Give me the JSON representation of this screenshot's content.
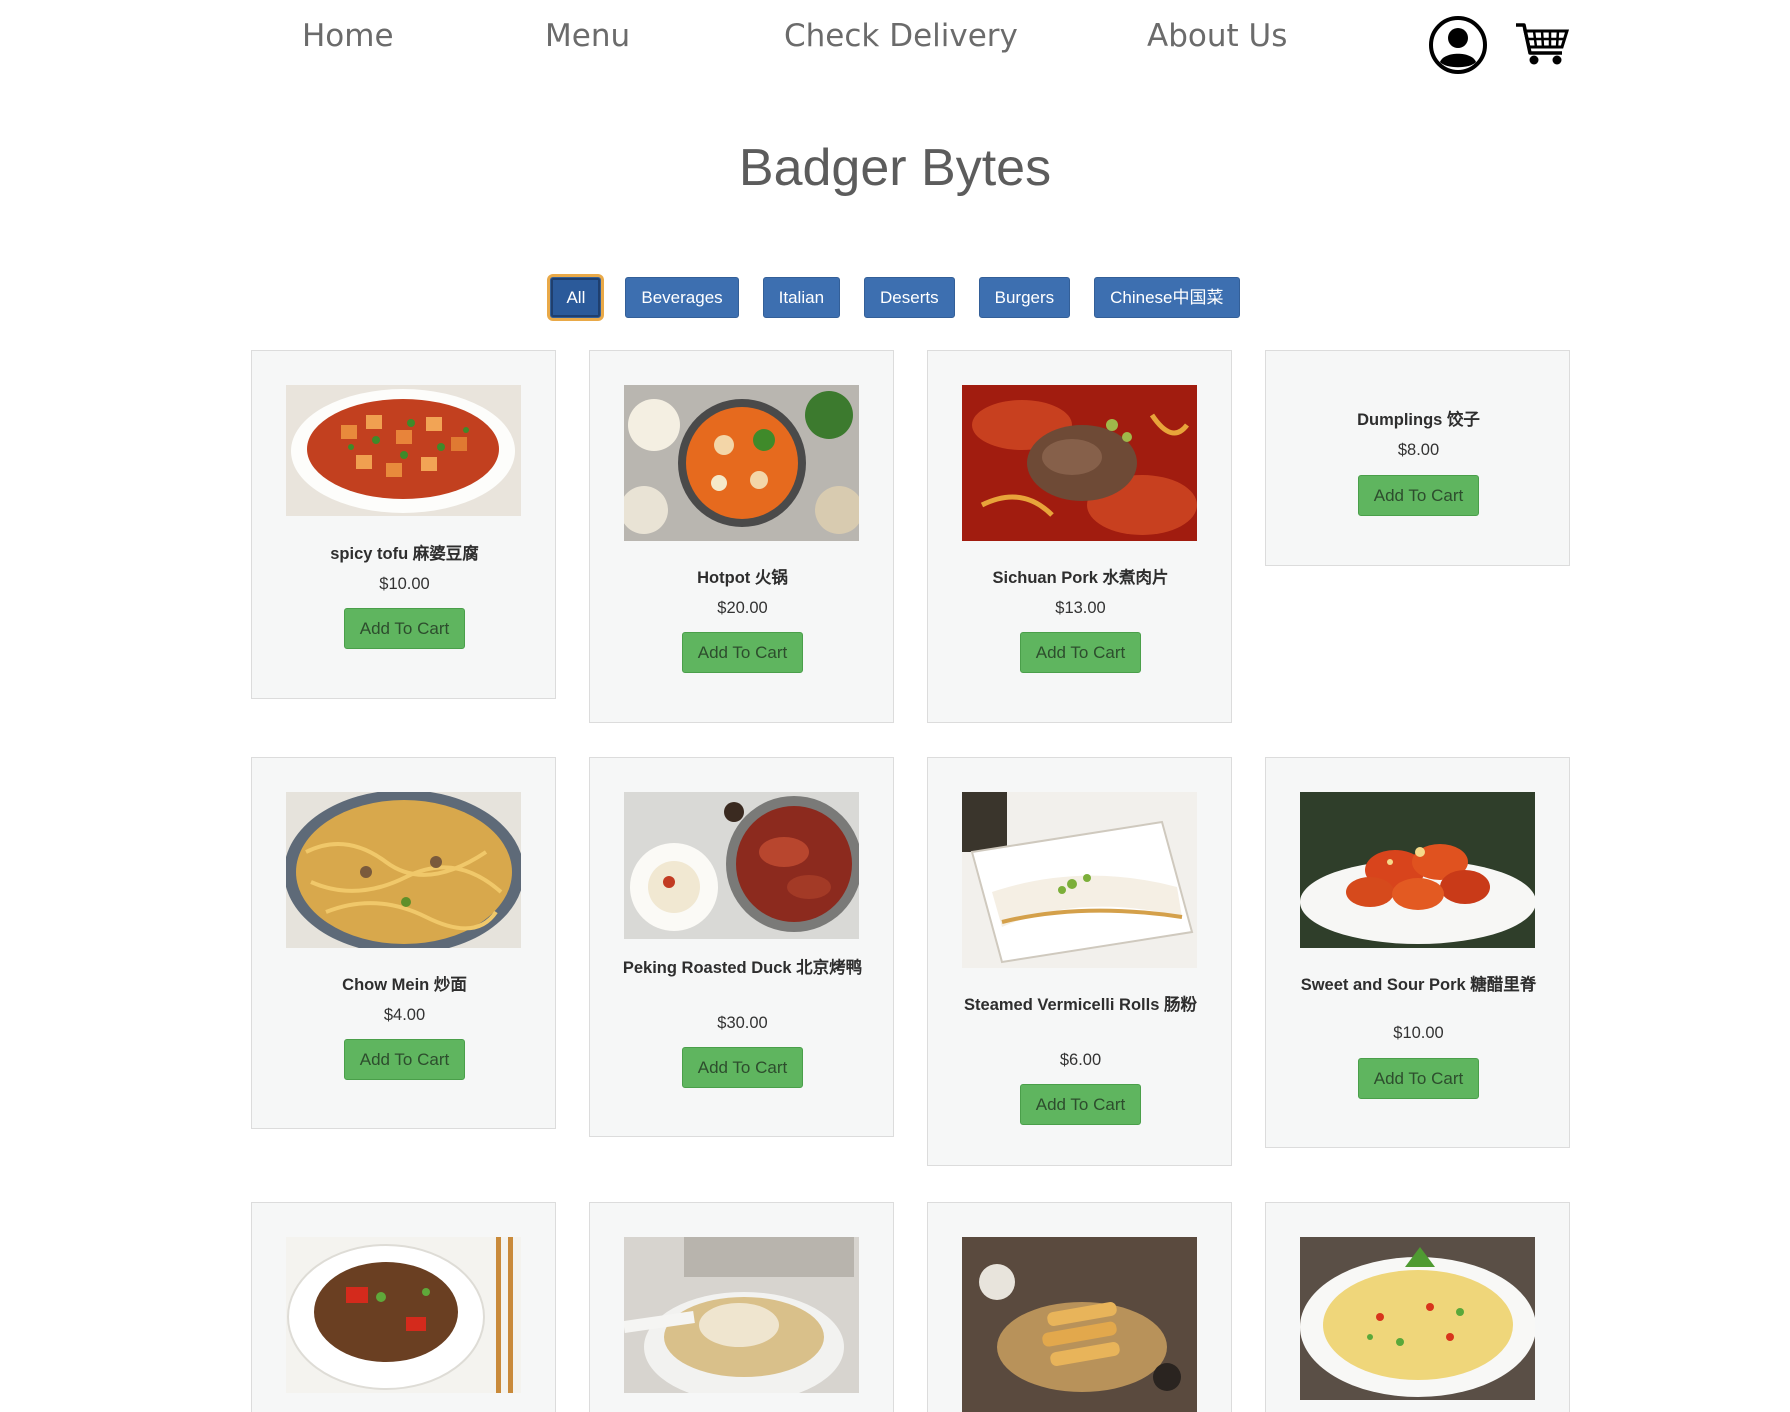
{
  "nav": {
    "home": "Home",
    "menu": "Menu",
    "check_delivery": "Check Delivery",
    "about_us": "About Us",
    "account_icon": "user-account-icon",
    "cart_icon": "shopping-cart-icon"
  },
  "title": "Badger Bytes",
  "filters": [
    {
      "label": "All",
      "active": true
    },
    {
      "label": "Beverages",
      "active": false
    },
    {
      "label": "Italian",
      "active": false
    },
    {
      "label": "Deserts",
      "active": false
    },
    {
      "label": "Burgers",
      "active": false
    },
    {
      "label": "Chinese中国菜",
      "active": false
    }
  ],
  "add_to_cart_label": "Add To Cart",
  "items": [
    {
      "name": "spicy tofu 麻婆豆腐",
      "price": "$10.00"
    },
    {
      "name": "Hotpot 火锅",
      "price": "$20.00"
    },
    {
      "name": "Sichuan Pork 水煮肉片",
      "price": "$13.00"
    },
    {
      "name": "Dumplings 饺子",
      "price": "$8.00"
    },
    {
      "name": "Chow Mein 炒面",
      "price": "$4.00"
    },
    {
      "name": "Peking Roasted Duck 北京烤鸭",
      "price": "$30.00"
    },
    {
      "name": "Steamed Vermicelli Rolls 肠粉",
      "price": "$6.00"
    },
    {
      "name": "Sweet and Sour Pork 糖醋里脊",
      "price": "$10.00"
    },
    {
      "name": "",
      "price": ""
    },
    {
      "name": "",
      "price": ""
    },
    {
      "name": "",
      "price": ""
    },
    {
      "name": "",
      "price": ""
    }
  ],
  "colors": {
    "filter_button": "#3d6fb0",
    "add_button": "#5fb55f",
    "card_background": "#f6f7f7",
    "active_focus_ring": "#e9a948"
  }
}
